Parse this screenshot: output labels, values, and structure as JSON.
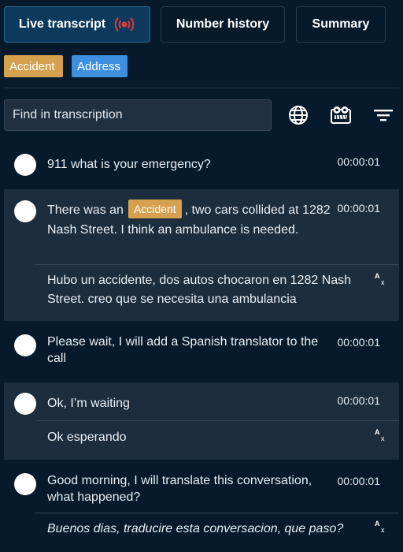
{
  "tabs": {
    "live": "Live transcript",
    "history": "Number history",
    "summary": "Summary"
  },
  "tags": {
    "accident": "Accident",
    "address": "Address"
  },
  "search": {
    "placeholder": "Find in transcription"
  },
  "toolbar_icons": [
    "globe-icon",
    "tape-icon",
    "filter-icon"
  ],
  "colors": {
    "background": "#061a2b",
    "shaded_row": "#1c2d3d",
    "active_tab": "#0d3a5c",
    "accident_tag": "#d6a14e",
    "address_tag": "#3e8fe0"
  },
  "messages": [
    {
      "text": "911 what is your emergency?",
      "time": "00:00:01"
    },
    {
      "text_before": "There was an",
      "tag": "Accident",
      "text_after": ", two cars collided at 1282 Nash Street. I think an ambulance is needed.",
      "time": "00:00:01",
      "translation": "Hubo un accidente, dos autos chocaron en 1282 Nash Street. creo que se necesita una ambulancia"
    },
    {
      "text": "Please wait, I will add a Spanish translator to the call",
      "time": "00:00:01"
    },
    {
      "text": "Ok, I’m waiting",
      "time": "00:00:01",
      "translation": "Ok esperando"
    },
    {
      "text": "Good morning, I will translate this conversation, what happened?",
      "time": "00:00:01",
      "translation": "Buenos dias, traducire esta conversacion, que paso?"
    }
  ]
}
